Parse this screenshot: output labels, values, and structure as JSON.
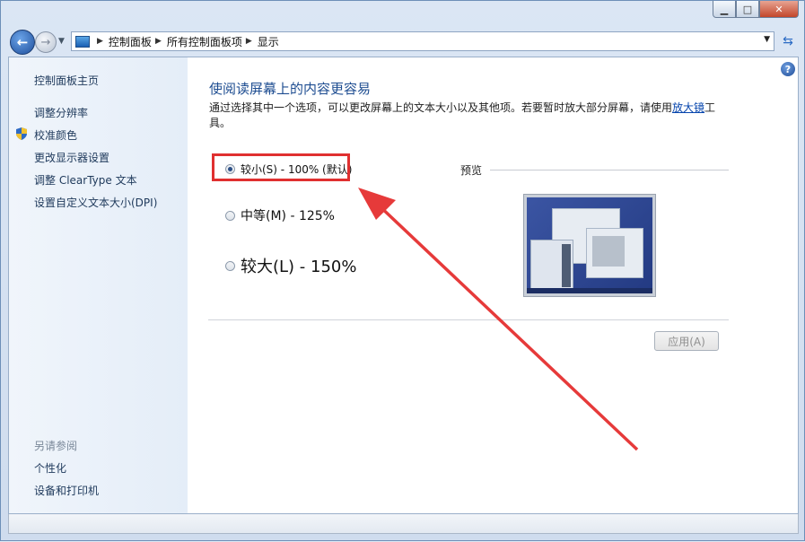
{
  "window": {
    "controls": {
      "minimize": "▁",
      "maximize": "□",
      "close": "✕"
    }
  },
  "nav": {
    "breadcrumb": [
      "控制面板",
      "所有控制面板项",
      "显示"
    ]
  },
  "sidebar": {
    "home": "控制面板主页",
    "items": [
      "调整分辨率",
      "校准颜色",
      "更改显示器设置",
      "调整 ClearType 文本",
      "设置自定义文本大小(DPI)"
    ],
    "see_also_title": "另请参阅",
    "see_also": [
      "个性化",
      "设备和打印机"
    ]
  },
  "main": {
    "title": "使阅读屏幕上的内容更容易",
    "desc_prefix": "通过选择其中一个选项，可以更改屏幕上的文本大小以及其他项。若要暂时放大部分屏幕，请使用",
    "desc_link": "放大镜",
    "desc_suffix": "工具。",
    "options": [
      {
        "label": "较小(S) - 100% (默认)",
        "selected": true
      },
      {
        "label": "中等(M) - 125%",
        "selected": false
      },
      {
        "label": "较大(L) - 150%",
        "selected": false
      }
    ],
    "preview_label": "预览",
    "apply_label": "应用(A)"
  },
  "colors": {
    "annotation": "#e03030",
    "title": "#1e4d91",
    "link": "#0645ad"
  }
}
